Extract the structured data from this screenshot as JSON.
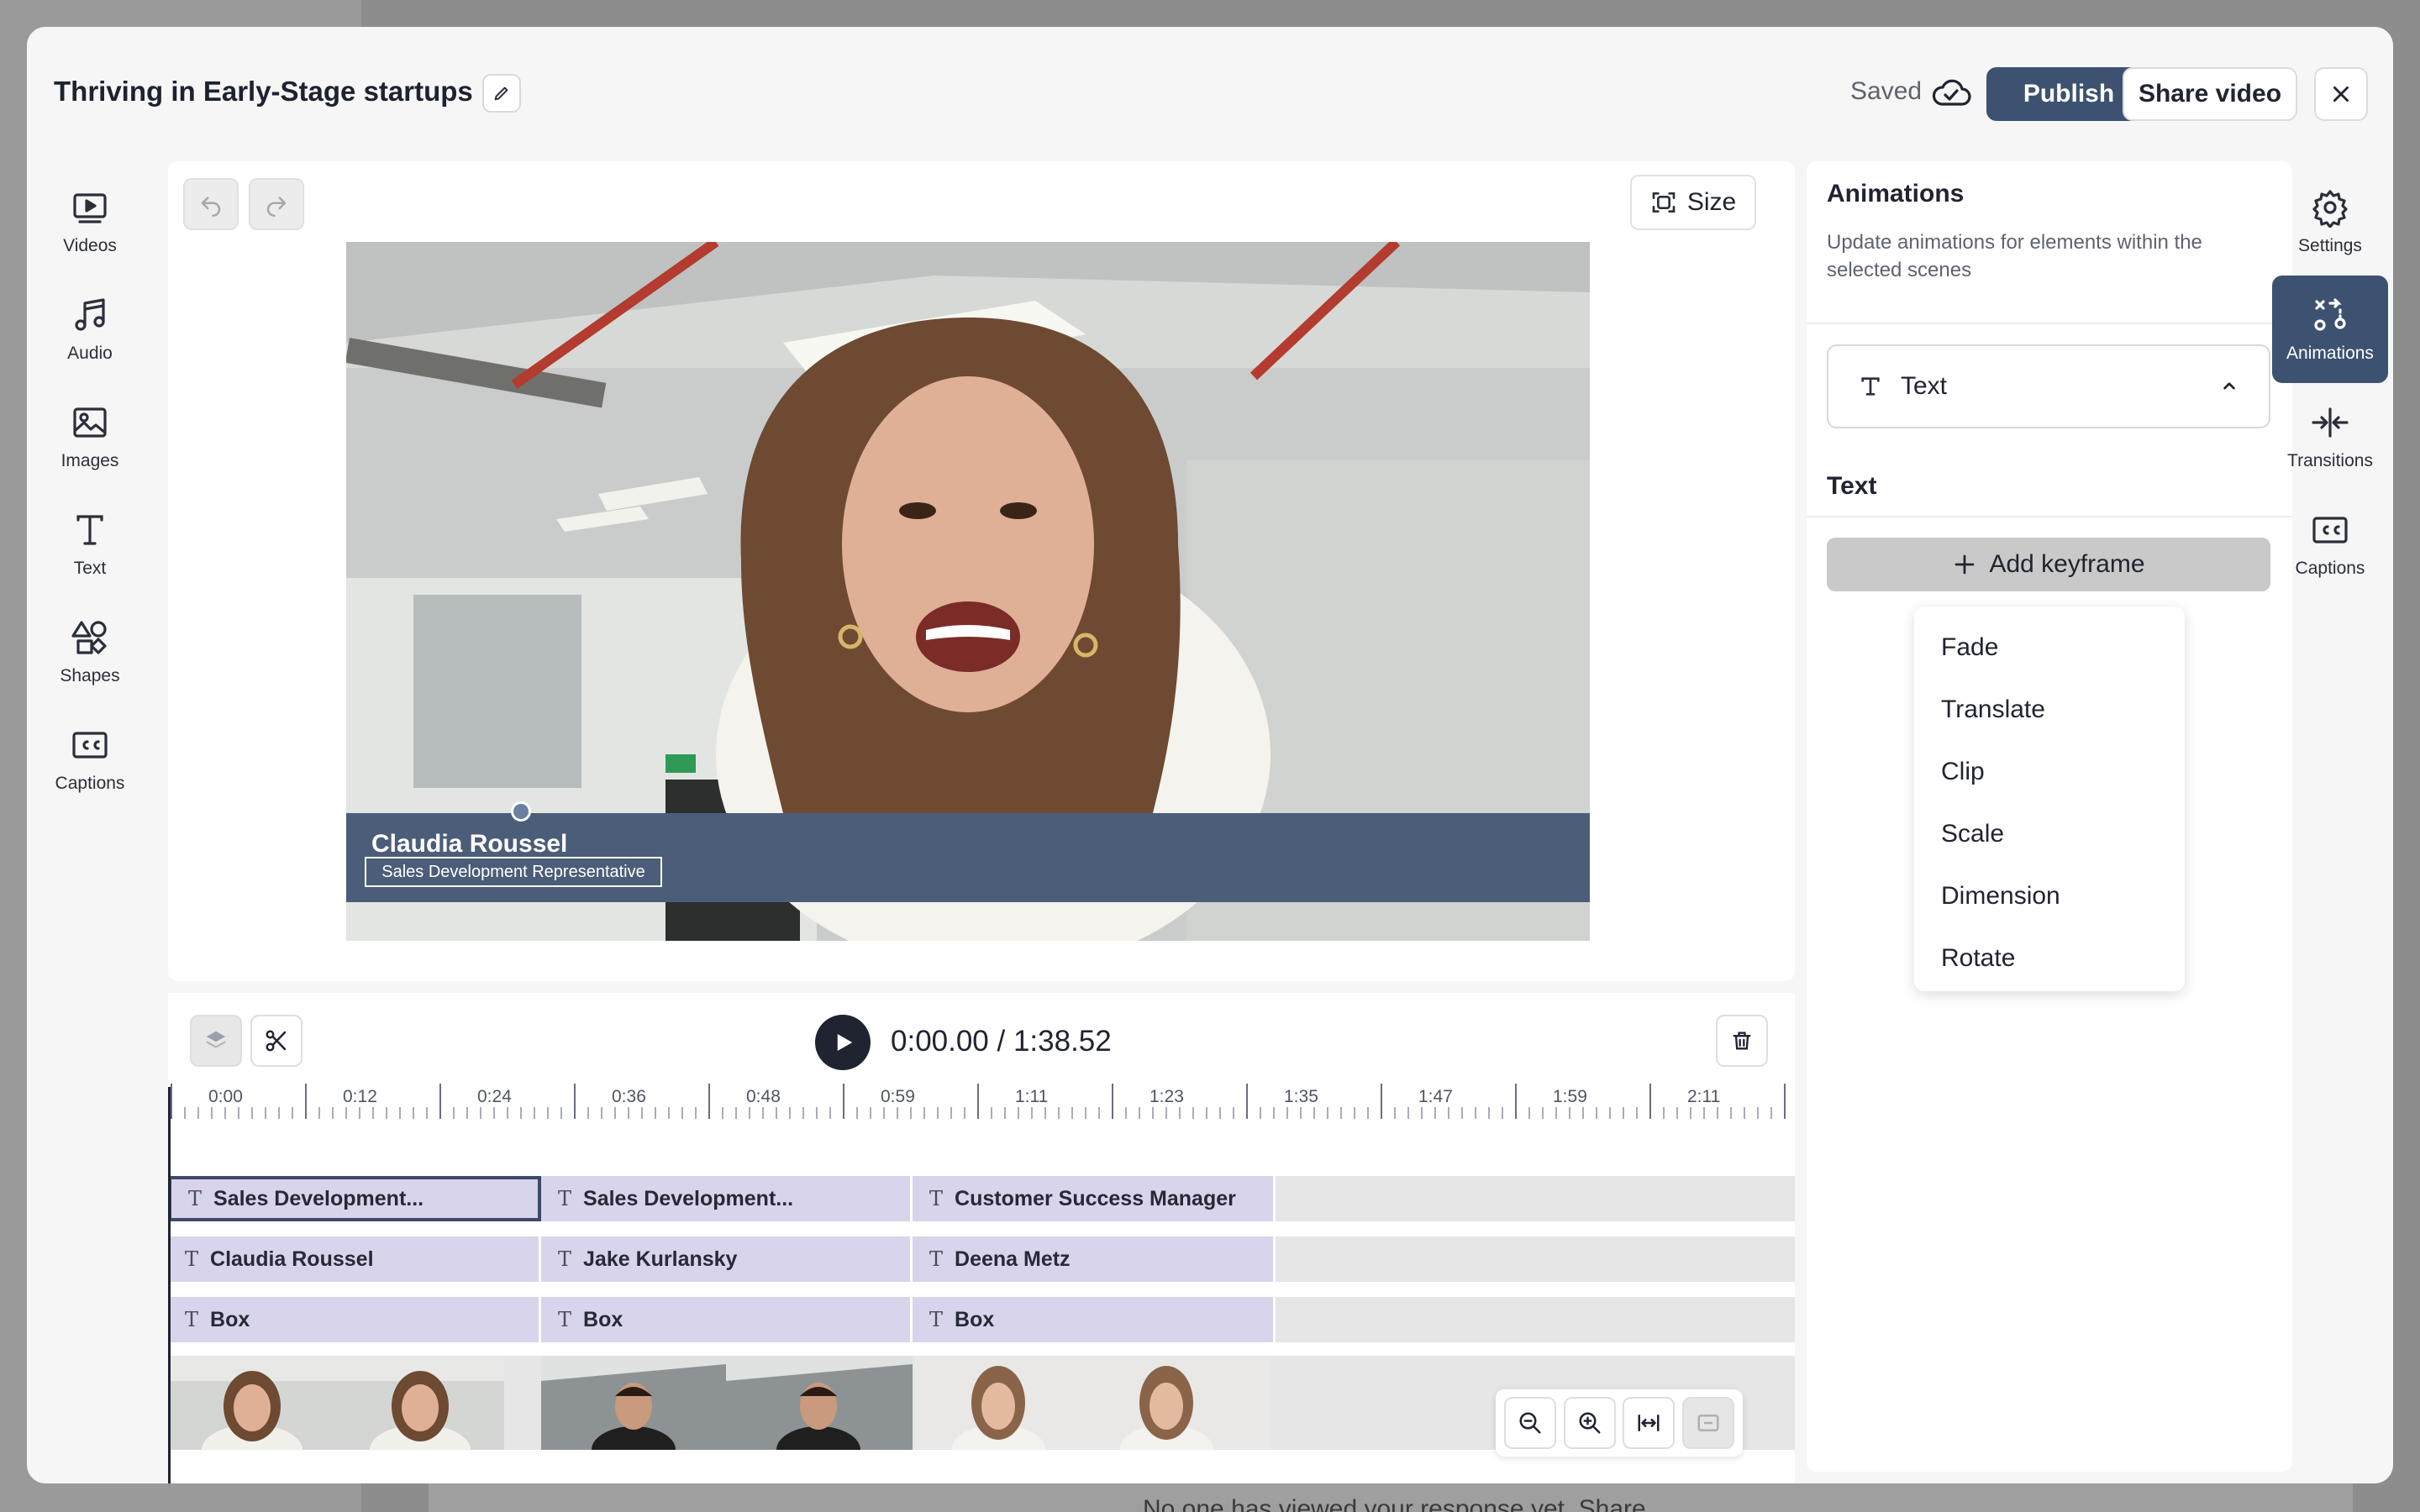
{
  "background": {
    "partial_text": "No one has viewed your response yet. Share"
  },
  "header": {
    "title": "Thriving in Early-Stage startups",
    "save_status": "Saved",
    "publish_label": "Publish",
    "share_label": "Share video"
  },
  "left_rail": [
    {
      "label": "Videos",
      "icon": "video-play-icon"
    },
    {
      "label": "Audio",
      "icon": "music-note-icon"
    },
    {
      "label": "Images",
      "icon": "image-icon"
    },
    {
      "label": "Text",
      "icon": "text-icon"
    },
    {
      "label": "Shapes",
      "icon": "shapes-icon"
    },
    {
      "label": "Captions",
      "icon": "cc-icon"
    }
  ],
  "right_rail": [
    {
      "label": "Settings",
      "icon": "gear-icon"
    },
    {
      "label": "Animations",
      "icon": "animations-icon",
      "active": true
    },
    {
      "label": "Transitions",
      "icon": "transitions-icon"
    },
    {
      "label": "Captions",
      "icon": "cc-icon"
    }
  ],
  "canvas": {
    "size_label": "Size",
    "lower_third": {
      "name": "Claudia Roussel",
      "role": "Sales Development Representative"
    }
  },
  "timeline": {
    "timecode": "0:00.00 / 1:38.52",
    "ticks": [
      "0:00",
      "0:12",
      "0:24",
      "0:36",
      "0:48",
      "0:59",
      "1:11",
      "1:23",
      "1:35",
      "1:47",
      "1:59",
      "2:11"
    ],
    "tracks": [
      [
        "Sales Development...",
        "Sales Development...",
        "Customer Success Manager"
      ],
      [
        "Claudia Roussel",
        "Jake Kurlansky",
        "Deena Metz"
      ],
      [
        "Box",
        "Box",
        "Box"
      ]
    ]
  },
  "panel": {
    "title": "Animations",
    "description": "Update animations for elements within the selected scenes",
    "element_select": "Text",
    "section_label": "Text",
    "add_keyframe_label": "Add keyframe",
    "menu": [
      "Fade",
      "Translate",
      "Clip",
      "Scale",
      "Dimension",
      "Rotate"
    ]
  },
  "colors": {
    "accent": "#3d5270",
    "clip": "#d8d4ec",
    "lower_third": "#4b5d78"
  }
}
